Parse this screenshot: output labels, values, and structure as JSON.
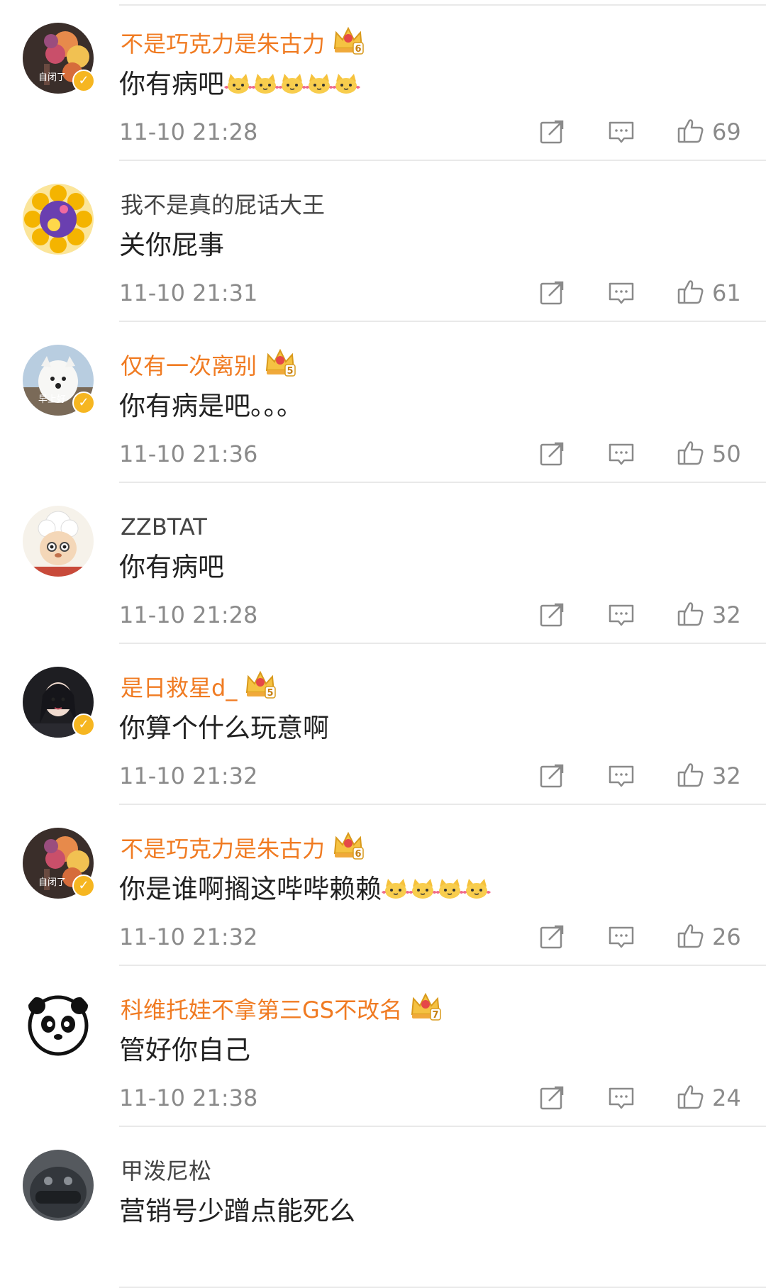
{
  "comments": [
    {
      "user": "不是巧克力是朱古力",
      "text": "你有病吧",
      "time": "11-10 21:28",
      "likes": "69",
      "vip": true,
      "crown_level": "6",
      "emoji_count": 5,
      "avatar_text": "自闭了",
      "verified": true
    },
    {
      "user": "我不是真的屁话大王",
      "text": "关你屁事",
      "time": "11-10 21:31",
      "likes": "61",
      "vip": false,
      "crown_level": "",
      "emoji_count": 0,
      "avatar_text": "",
      "verified": false
    },
    {
      "user": "仅有一次离别",
      "text": "你有病是吧。。。",
      "time": "11-10 21:36",
      "likes": "50",
      "vip": true,
      "crown_level": "5",
      "emoji_count": 0,
      "avatar_text": "早上好",
      "verified": true
    },
    {
      "user": "ZZBTAT",
      "text": "你有病吧",
      "time": "11-10 21:28",
      "likes": "32",
      "vip": false,
      "crown_level": "",
      "emoji_count": 0,
      "avatar_text": "",
      "verified": false
    },
    {
      "user": "是日救星d_",
      "text": "你算个什么玩意啊",
      "time": "11-10 21:32",
      "likes": "32",
      "vip": true,
      "crown_level": "5",
      "emoji_count": 0,
      "avatar_text": "",
      "verified": true
    },
    {
      "user": "不是巧克力是朱古力",
      "text": "你是谁啊搁这哔哔赖赖",
      "time": "11-10 21:32",
      "likes": "26",
      "vip": true,
      "crown_level": "6",
      "emoji_count": 4,
      "avatar_text": "自闭了",
      "verified": true
    },
    {
      "user": "科维托娃不拿第三GS不改名",
      "text": "管好你自己",
      "time": "11-10 21:38",
      "likes": "24",
      "vip": true,
      "crown_level": "7",
      "emoji_count": 0,
      "avatar_text": "",
      "verified": false
    },
    {
      "user": "甲泼尼松",
      "text": "营销号少蹭点能死么",
      "time": "",
      "likes": "",
      "vip": false,
      "crown_level": "",
      "emoji_count": 0,
      "avatar_text": "",
      "verified": false
    }
  ],
  "icons": {
    "share": "share-icon",
    "reply": "comment-icon",
    "like": "thumbs-up-icon",
    "crown": "vip-crown-icon",
    "emoji": "cat-emoji-icon",
    "verified": "verified-badge-icon"
  },
  "colors": {
    "vip_name": "#f07b22",
    "normal_name": "#444444",
    "content": "#222222",
    "meta": "#8a8a8a",
    "divider": "#e9e9e9",
    "verified_badge": "#f6b621"
  }
}
